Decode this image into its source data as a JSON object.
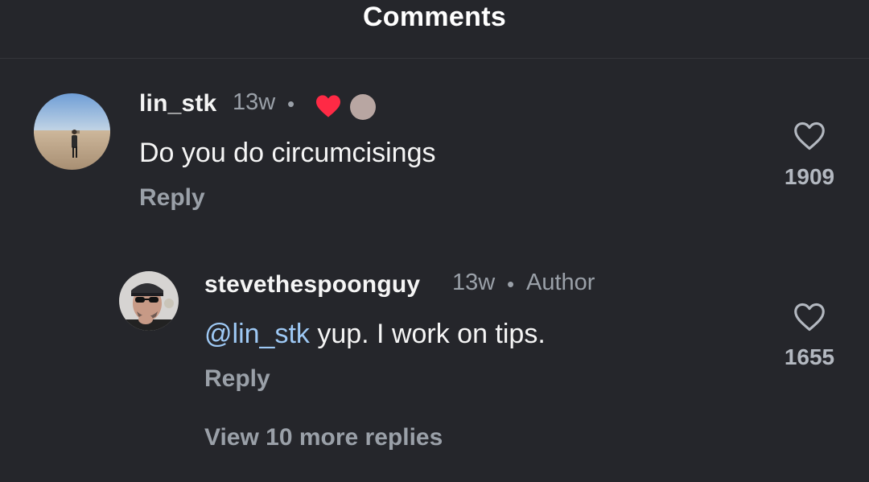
{
  "header": {
    "title": "Comments"
  },
  "comments": [
    {
      "username": "lin_stk",
      "time": "13w",
      "separator": "•",
      "text": "Do you do circumcisings",
      "reply_label": "Reply",
      "likes": "1909",
      "author_liked": true
    }
  ],
  "replies": [
    {
      "username": "stevethespoonguy",
      "time": "13w",
      "separator": "•",
      "author_badge": "Author",
      "mention": "@lin_stk",
      "text": " yup. I work on tips.",
      "reply_label": "Reply",
      "likes": "1655"
    }
  ],
  "view_more_label": "View 10 more replies",
  "colors": {
    "background": "#25262b",
    "heart_red": "#ff2a45",
    "mention": "#9ec9f5",
    "muted": "#9aa0a8"
  },
  "icons": {
    "like": "heart-outline-icon",
    "author_like": "heart-filled-icon"
  }
}
